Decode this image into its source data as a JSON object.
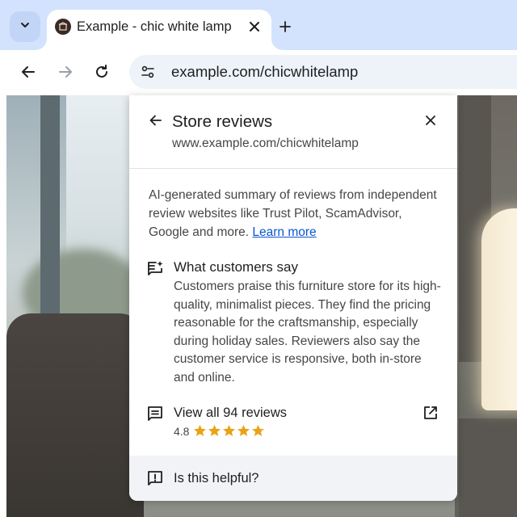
{
  "browser": {
    "tab": {
      "title": "Example - chic white lamp"
    },
    "address_bar": {
      "url": "example.com/chicwhitelamp"
    }
  },
  "reviews_panel": {
    "title": "Store reviews",
    "site": "www.example.com/chicwhitelamp",
    "intro_text": "AI-generated summary of reviews from independent review websites like Trust Pilot, ScamAdvisor, Google and more.",
    "learn_more": "Learn more",
    "customers_heading": "What customers say",
    "customers_summary": "Customers praise this furniture store for its high-quality, minimalist pieces. They find the pricing reasonable for the craftsmanship, especially during holiday sales. Reviewers also say the customer service is responsive, both in-store and online.",
    "view_reviews": "View all 94 reviews",
    "rating": "4.8",
    "rating_value": 4.8,
    "rating_max": 5,
    "helpful_prompt": "Is this helpful?"
  },
  "colors": {
    "tabstrip": "#d3e3fd",
    "link": "#0b57d0",
    "star": "#e8a317",
    "footer": "#f1f3f6"
  },
  "icons": {
    "tab_menu": "chevron-down-icon",
    "favicon": "store-favicon-icon",
    "tab_close": "close-icon",
    "new_tab": "plus-icon",
    "back": "arrow-left-icon",
    "forward": "arrow-right-icon",
    "reload": "reload-icon",
    "site_info": "tune-icon",
    "panel_back": "arrow-left-icon",
    "panel_close": "close-icon",
    "customers": "ai-summary-icon",
    "reviews": "comment-icon",
    "open_external": "open-in-new-icon",
    "helpful": "feedback-icon"
  }
}
